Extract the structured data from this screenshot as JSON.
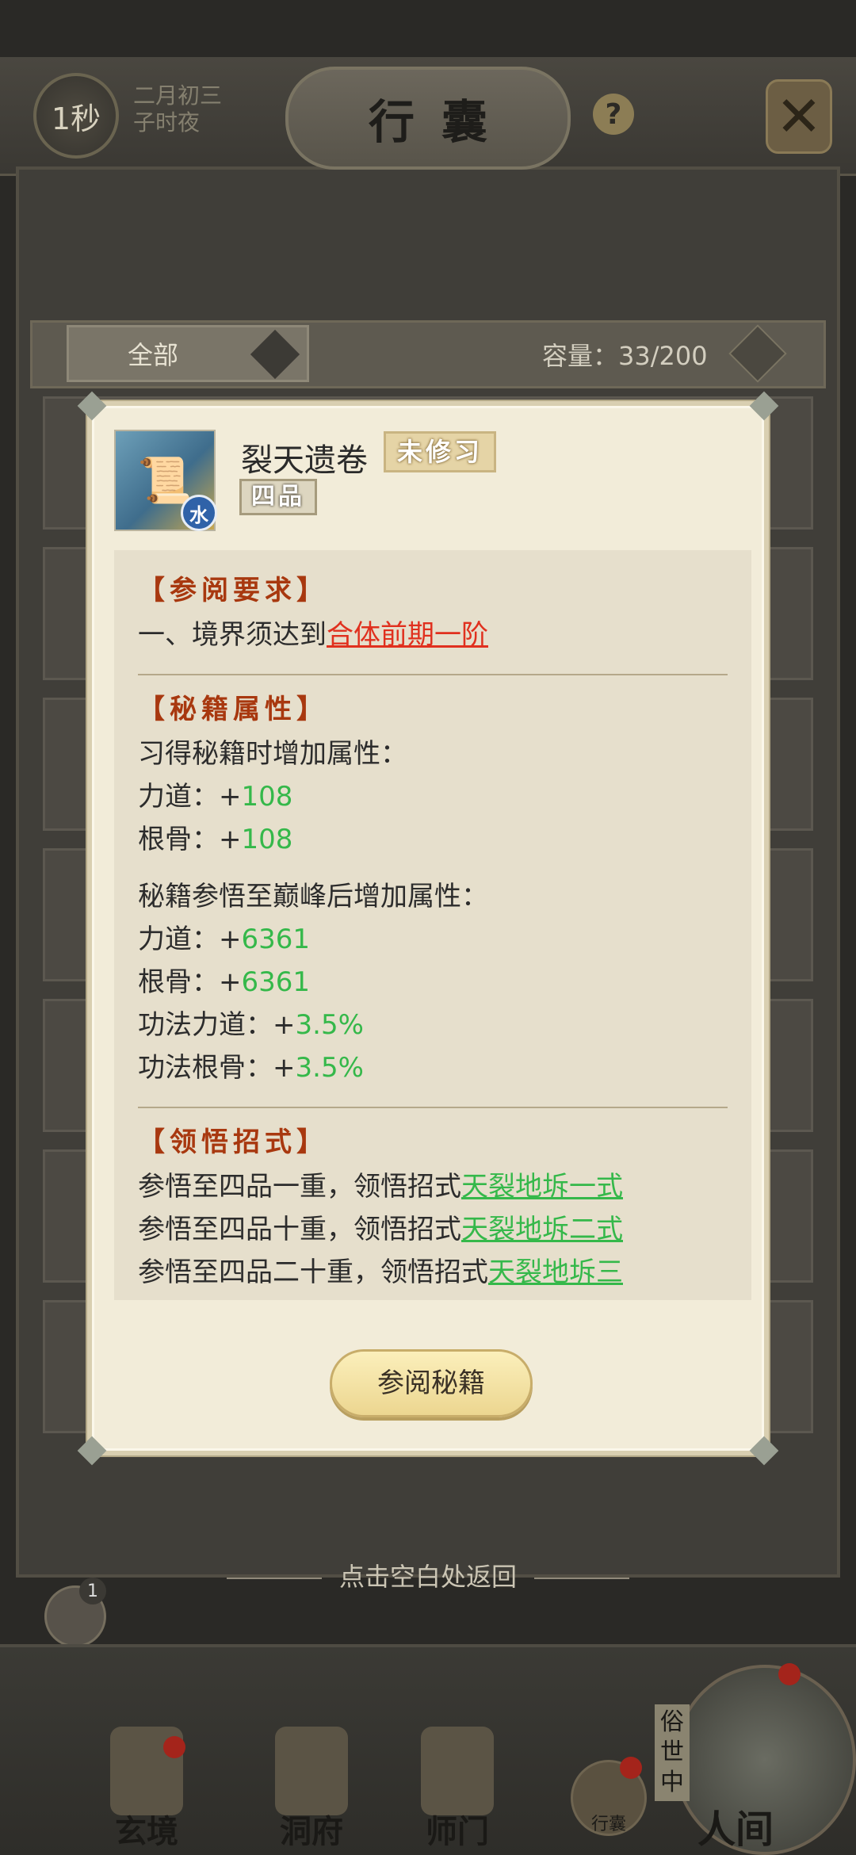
{
  "header": {
    "timer": "1秒",
    "date_line1": "二月初三",
    "date_line2": "子时夜",
    "title": "行囊"
  },
  "filter": {
    "selected": "全部",
    "capacity": "容量：33/200"
  },
  "item": {
    "name": "裂天遗卷",
    "learn_status": "未修习",
    "grade": "四品",
    "element": "水"
  },
  "requirements": {
    "title": "【参阅要求】",
    "line_prefix": "一、境界须达到",
    "line_link": "合体前期一阶"
  },
  "attributes": {
    "title": "【秘籍属性】",
    "learn_header": "习得秘籍时增加属性：",
    "learn_attrs": [
      {
        "label": "力道：+",
        "value": "108"
      },
      {
        "label": "根骨：+",
        "value": "108"
      }
    ],
    "peak_header": "秘籍参悟至巅峰后增加属性：",
    "peak_attrs": [
      {
        "label": "力道：+",
        "value": "6361"
      },
      {
        "label": "根骨：+",
        "value": "6361"
      },
      {
        "label": "功法力道：+",
        "value": "3.5%"
      },
      {
        "label": "功法根骨：+",
        "value": "3.5%"
      }
    ]
  },
  "skills": {
    "title": "【领悟招式】",
    "rows": [
      {
        "prefix": "参悟至四品一重，领悟招式",
        "skill": "天裂地坼一式"
      },
      {
        "prefix": "参悟至四品十重，领悟招式",
        "skill": "天裂地坼二式"
      },
      {
        "prefix": "参悟至四品二十重，领悟招式",
        "skill": "天裂地坼三"
      }
    ]
  },
  "action_button": "参阅秘籍",
  "hint": "点击空白处返回",
  "chat_badge": "1",
  "bottom_nav": {
    "items": [
      "玄境",
      "洞府",
      "师门"
    ],
    "bag": "行囊",
    "world_side": "俗世中",
    "world": "人间"
  },
  "colors": {
    "requirement_link": "#e0301e",
    "value_green": "#35b84a",
    "section_title": "#a8380f"
  }
}
